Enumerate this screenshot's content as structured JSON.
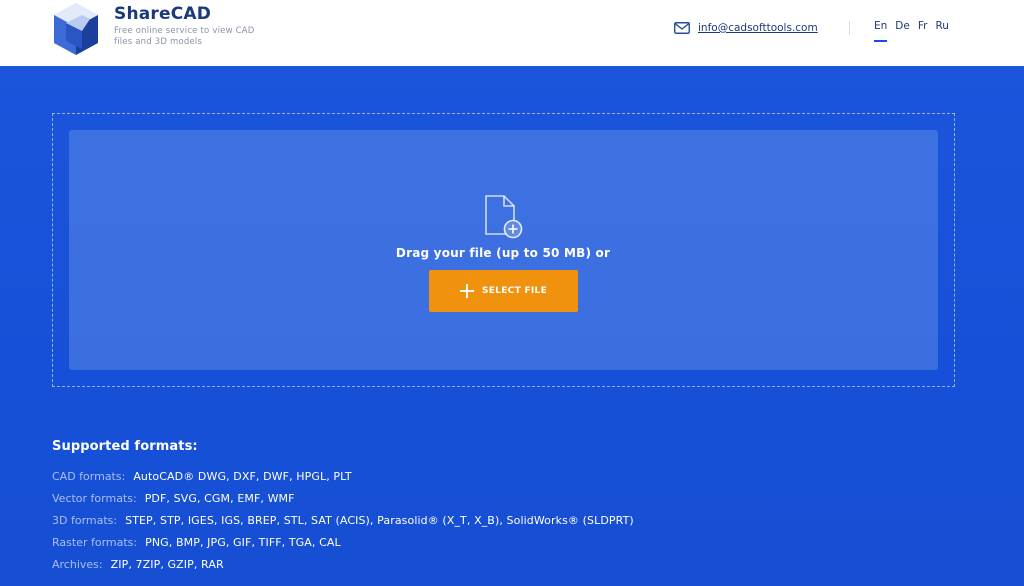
{
  "header": {
    "brand_name": "ShareCAD",
    "tagline": "Free online service to view CAD files and 3D models",
    "contact_email": "info@cadsofttools.com",
    "languages": [
      {
        "code": "En",
        "active": true
      },
      {
        "code": "De",
        "active": false
      },
      {
        "code": "Fr",
        "active": false
      },
      {
        "code": "Ru",
        "active": false
      }
    ]
  },
  "upload": {
    "drag_text": "Drag your file (up to 50 MB) or",
    "select_button_label": "SELECT FILE"
  },
  "formats": {
    "title": "Supported formats:",
    "rows": [
      {
        "label": "CAD formats:",
        "values": "AutoCAD® DWG, DXF, DWF, HPGL, PLT"
      },
      {
        "label": "Vector formats:",
        "values": "PDF, SVG, CGM, EMF, WMF"
      },
      {
        "label": "3D formats:",
        "values": "STEP, STP, IGES, IGS, BREP, STL, SAT (ACIS), Parasolid® (X_T, X_B), SolidWorks® (SLDPRT)"
      },
      {
        "label": "Raster formats:",
        "values": "PNG, BMP, JPG, GIF, TIFF, TGA, CAL"
      },
      {
        "label": "Archives:",
        "values": "ZIP, 7ZIP, GZIP, RAR"
      }
    ]
  },
  "colors": {
    "brand_blue": "#1650d8",
    "accent_orange": "#f0920d",
    "header_text": "#1c3a7a"
  },
  "icons": {
    "logo": "sharecad-cube-logo",
    "mail": "mail-icon",
    "file_add": "file-add-icon",
    "plus": "plus-icon"
  }
}
